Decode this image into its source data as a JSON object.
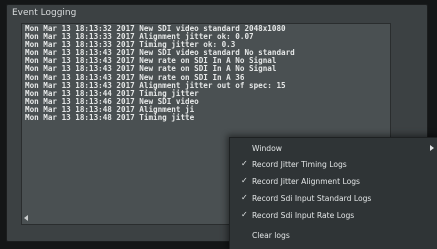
{
  "panel": {
    "title": "Event Logging"
  },
  "log": {
    "lines": [
      "Mon Mar 13 18:13:32 2017 New SDI video standard 2048x1080",
      "Mon Mar 13 18:13:33 2017 Alignment jitter ok: 0.07",
      "Mon Mar 13 18:13:33 2017 Timing jitter ok: 0.3",
      "Mon Mar 13 18:13:43 2017 New SDI video standard No standard",
      "Mon Mar 13 18:13:43 2017 New rate on SDI In A  No Signal",
      "Mon Mar 13 18:13:43 2017 New rate on SDI In A  No Signal",
      "Mon Mar 13 18:13:43 2017 New rate on SDI In A  36",
      "Mon Mar 13 18:13:43 2017 Alignment jitter out of spec: 15",
      "Mon Mar 13 18:13:44 2017 Timing jitter",
      "Mon Mar 13 18:13:46 2017 New SDI video",
      "Mon Mar 13 18:13:48 2017 Alignment ji",
      "Mon Mar 13 18:13:48 2017 Timing jitte"
    ]
  },
  "menu": {
    "window_label": "Window",
    "items": [
      {
        "label": "Record Jitter Timing Logs",
        "checked": true
      },
      {
        "label": "Record Jitter Alignment Logs",
        "checked": true
      },
      {
        "label": "Record Sdi Input Standard Logs",
        "checked": true
      },
      {
        "label": "Record Sdi Input Rate Logs",
        "checked": true
      }
    ],
    "clear_label": "Clear logs",
    "check_glyph": "✓"
  },
  "colors": {
    "panel_bg": "#3c4143",
    "log_bg": "#4a5052",
    "menu_bg": "#2f3436",
    "text": "#e6e8e8"
  }
}
